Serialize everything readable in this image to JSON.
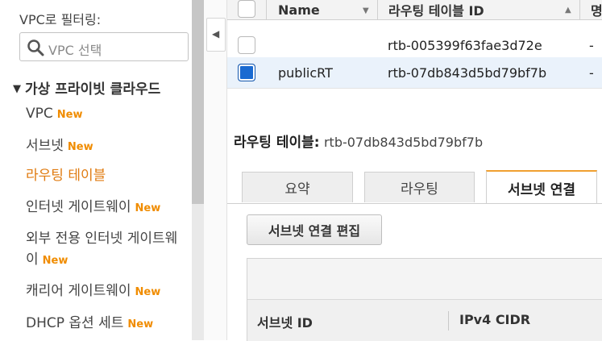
{
  "sidebar": {
    "filter_label": "VPC로 필터링:",
    "vpc_select_placeholder": "VPC 선택",
    "section_title": "가상 프라이빗 클라우드",
    "new_badge": "New",
    "items": [
      {
        "label": "VPC",
        "new": true
      },
      {
        "label": "서브넷",
        "new": true
      },
      {
        "label": "라우팅 테이블",
        "new": false,
        "active": true
      },
      {
        "label": "인터넷 게이트웨이",
        "new": true
      },
      {
        "label": "외부 전용 인터넷 게이트웨이",
        "new": true
      },
      {
        "label": "캐리어 게이트웨이",
        "new": true
      },
      {
        "label": "DHCP 옵션 세트",
        "new": true
      }
    ]
  },
  "table": {
    "columns": [
      "Name",
      "라우팅 테이블 ID",
      "명"
    ],
    "rows": [
      {
        "name": "",
        "id": "rtb-005399f63fae3d72e",
        "extra": "-",
        "selected": false
      },
      {
        "name": "publicRT",
        "id": "rtb-07db843d5bd79bf7b",
        "extra": "-",
        "selected": true
      }
    ]
  },
  "detail": {
    "label": "라우팅 테이블:",
    "value": "rtb-07db843d5bd79bf7b",
    "tabs": [
      "요약",
      "라우팅",
      "서브넷 연결"
    ],
    "active_tab": 2,
    "edit_button": "서브넷 연결 편집",
    "subnet_columns": [
      "서브넷 ID",
      "IPv4 CIDR"
    ]
  },
  "colors": {
    "accent_orange": "#e07b10",
    "checkbox_blue": "#1a6ad1"
  }
}
